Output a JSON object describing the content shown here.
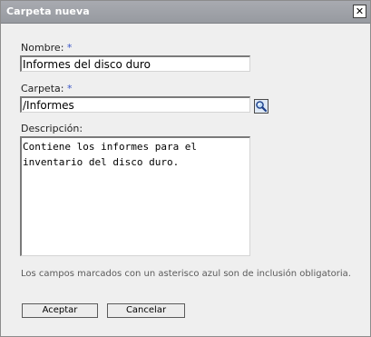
{
  "window": {
    "title": "Carpeta nueva",
    "close_icon": "close-icon",
    "close_glyph": "✕"
  },
  "form": {
    "name": {
      "label": "Nombre:",
      "required_mark": "*",
      "value": "Informes del disco duro"
    },
    "folder": {
      "label": "Carpeta:",
      "required_mark": "*",
      "value": "/Informes",
      "browse_icon": "magnifier-icon"
    },
    "description": {
      "label": "Descripción:",
      "value": "Contiene los informes para el\ninventario del disco duro."
    },
    "required_hint": "Los campos marcados con un asterisco azul son de inclusión obligatoria."
  },
  "buttons": {
    "accept_label": "Aceptar",
    "cancel_label": "Cancelar"
  },
  "colors": {
    "titlebar": "#9fa2a8",
    "required_asterisk": "#3c56c8",
    "dialog_background": "#efefef"
  }
}
